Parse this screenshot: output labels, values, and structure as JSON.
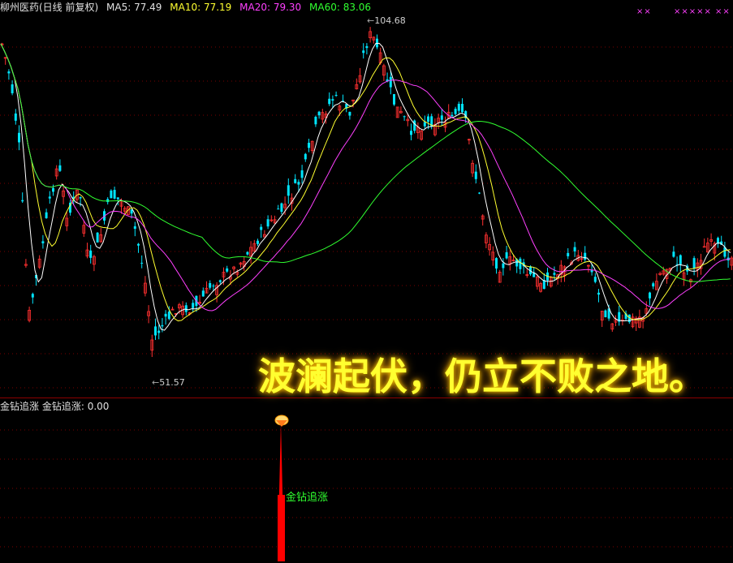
{
  "header": {
    "title": "柳州医药(日线 前复权)",
    "ma5": "MA5: 77.49",
    "ma10": "MA10: 77.19",
    "ma20": "MA20: 79.30",
    "ma60": "MA60: 83.06"
  },
  "marks": {
    "group1": "××",
    "group2": "×××××",
    "group3": "××"
  },
  "annotations": {
    "high": "104.68",
    "low": "51.57"
  },
  "slogan": "波澜起伏，仍立不败之地。",
  "indicator": {
    "header_name": "金钻追涨",
    "header_value": "金钻追涨: 0.00",
    "signal_label": "金钻追涨"
  },
  "colors": {
    "background": "#000000",
    "up_candle": "#ff3030",
    "down_candle": "#00e5ff",
    "ma5": "#ffffff",
    "ma10": "#ffff30",
    "ma20": "#ff40ff",
    "ma60": "#30ff30",
    "grid": "#7a0000",
    "signal": "#ff0000"
  }
}
